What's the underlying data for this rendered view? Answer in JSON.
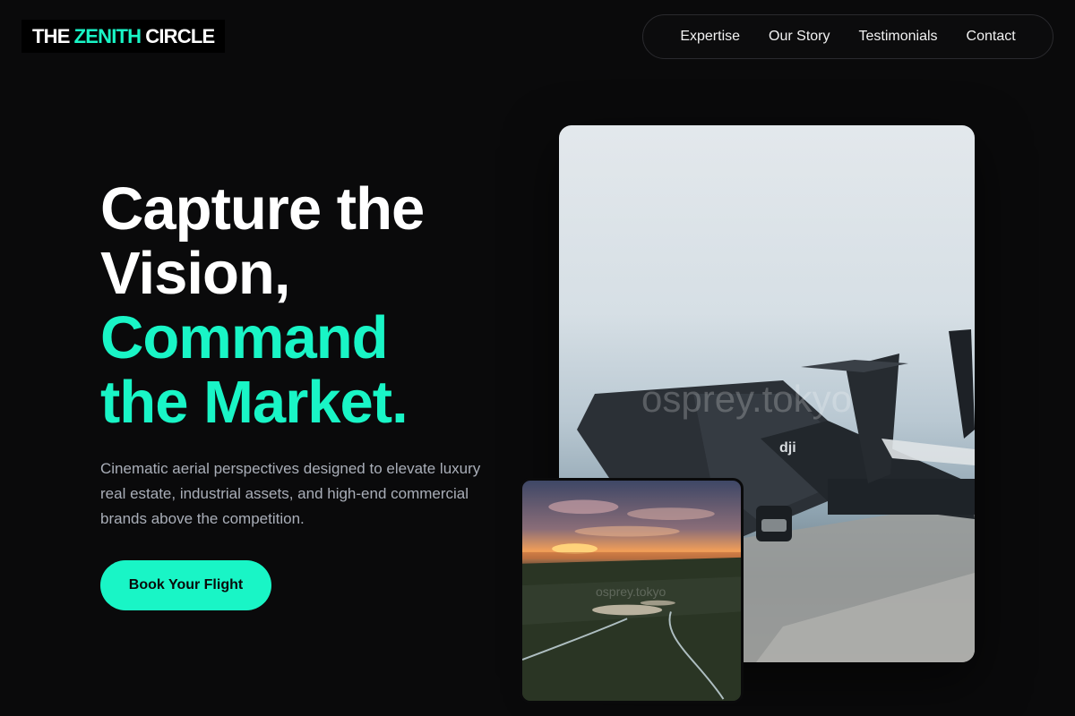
{
  "brand": {
    "part1": "THE",
    "accent": "ZENITH",
    "part2": "CIRCLE"
  },
  "nav": {
    "items": [
      {
        "label": "Expertise"
      },
      {
        "label": "Our Story"
      },
      {
        "label": "Testimonials"
      },
      {
        "label": "Contact"
      }
    ]
  },
  "hero": {
    "headline_white_1": "Capture the",
    "headline_white_2": "Vision,",
    "headline_green_1": "Command",
    "headline_green_2": "the Market.",
    "subtext": "Cinematic aerial perspectives designed to elevate luxury real estate, industrial assets, and high-end commercial brands above the competition.",
    "cta_label": "Book Your Flight"
  },
  "images": {
    "main_watermark": "osprey.tokyo",
    "small_watermark": "osprey.tokyo",
    "drone_brand_mark": "dji"
  },
  "colors": {
    "accent": "#19f5c6",
    "background": "#0a0a0b",
    "subtext": "#a9aeb8"
  }
}
